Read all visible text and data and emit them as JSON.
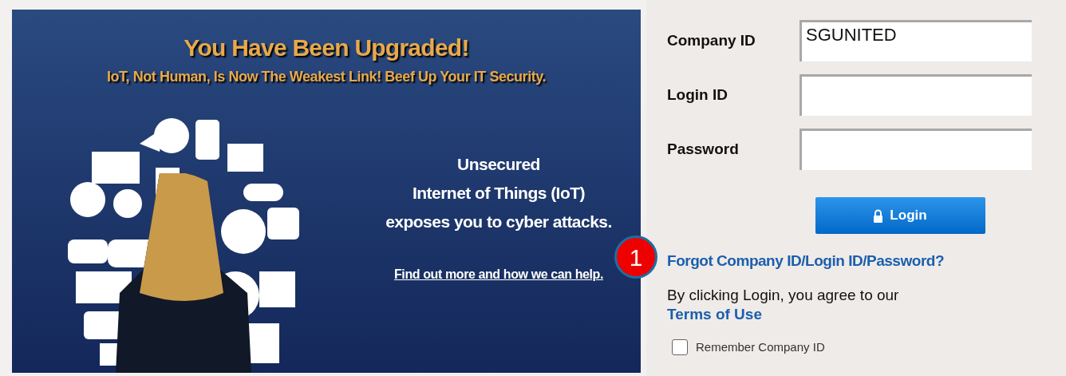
{
  "banner": {
    "title": "You Have Been Upgraded!",
    "subtitle": "IoT, Not Human, Is Now The Weakest Link! Beef Up Your IT Security.",
    "message": [
      "Unsecured",
      "Internet of Things (IoT)",
      "exposes you to cyber attacks."
    ],
    "link": "Find out more and how we can help."
  },
  "callout": {
    "number": "1"
  },
  "form": {
    "fields": [
      {
        "label": "Company ID",
        "value": "SGUNITED"
      },
      {
        "label": "Login ID"
      },
      {
        "label": "Password"
      }
    ],
    "button": "Login",
    "forgot_link": "Forgot Company ID/Login ID/Password?",
    "agreement": "By clicking Login, you agree to our",
    "terms_link": "Terms of Use",
    "remember": {
      "label": "Remember Company ID",
      "checked": false
    }
  }
}
